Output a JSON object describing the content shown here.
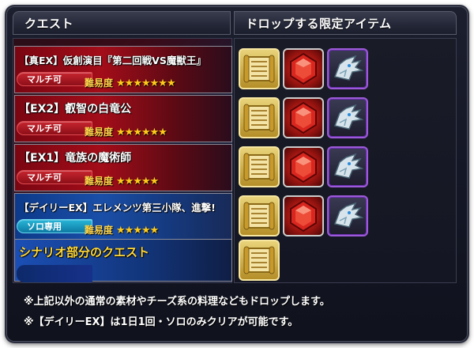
{
  "header": {
    "quest_label": "クエスト",
    "drops_label": "ドロップする限定アイテム"
  },
  "quests": [
    {
      "title": "【真EX】仮創演目『第二回戦VS魔獣王』",
      "badge": "マルチ可",
      "difficulty_label": "難易度",
      "stars": "★★★★★★★",
      "star_count": 7,
      "items": [
        "gold-scroll",
        "red-gem",
        "dragon-head"
      ]
    },
    {
      "title": "【EX2】叡智の白竜公",
      "badge": "マルチ可",
      "difficulty_label": "難易度",
      "stars": "★★★★★★",
      "star_count": 6,
      "items": [
        "gold-scroll",
        "red-gem",
        "dragon-head"
      ]
    },
    {
      "title": "【EX1】竜族の魔術師",
      "badge": "マルチ可",
      "difficulty_label": "難易度",
      "stars": "★★★★★",
      "star_count": 5,
      "items": [
        "gold-scroll",
        "red-gem",
        "dragon-head"
      ]
    },
    {
      "title": "【デイリーEX】エレメンツ第三小隊、進撃!",
      "badge": "ソロ専用",
      "difficulty_label": "難易度",
      "stars": "★★★★★",
      "star_count": 5,
      "items": [
        "gold-scroll",
        "red-gem",
        "dragon-head"
      ]
    }
  ],
  "scenario": {
    "title": "シナリオ部分のクエスト",
    "items": [
      "gold-scroll"
    ]
  },
  "notes": [
    "※上記以外の通常の素材やチーズ系の料理などもドロップします。",
    "※【デイリーEX】は1日1回・ソロのみクリアが可能です。"
  ],
  "colors": {
    "badge_multi": "#c7252f",
    "badge_solo": "#28b6d8",
    "star": "#ffcc1a",
    "scenario_title": "#ffd93a"
  }
}
